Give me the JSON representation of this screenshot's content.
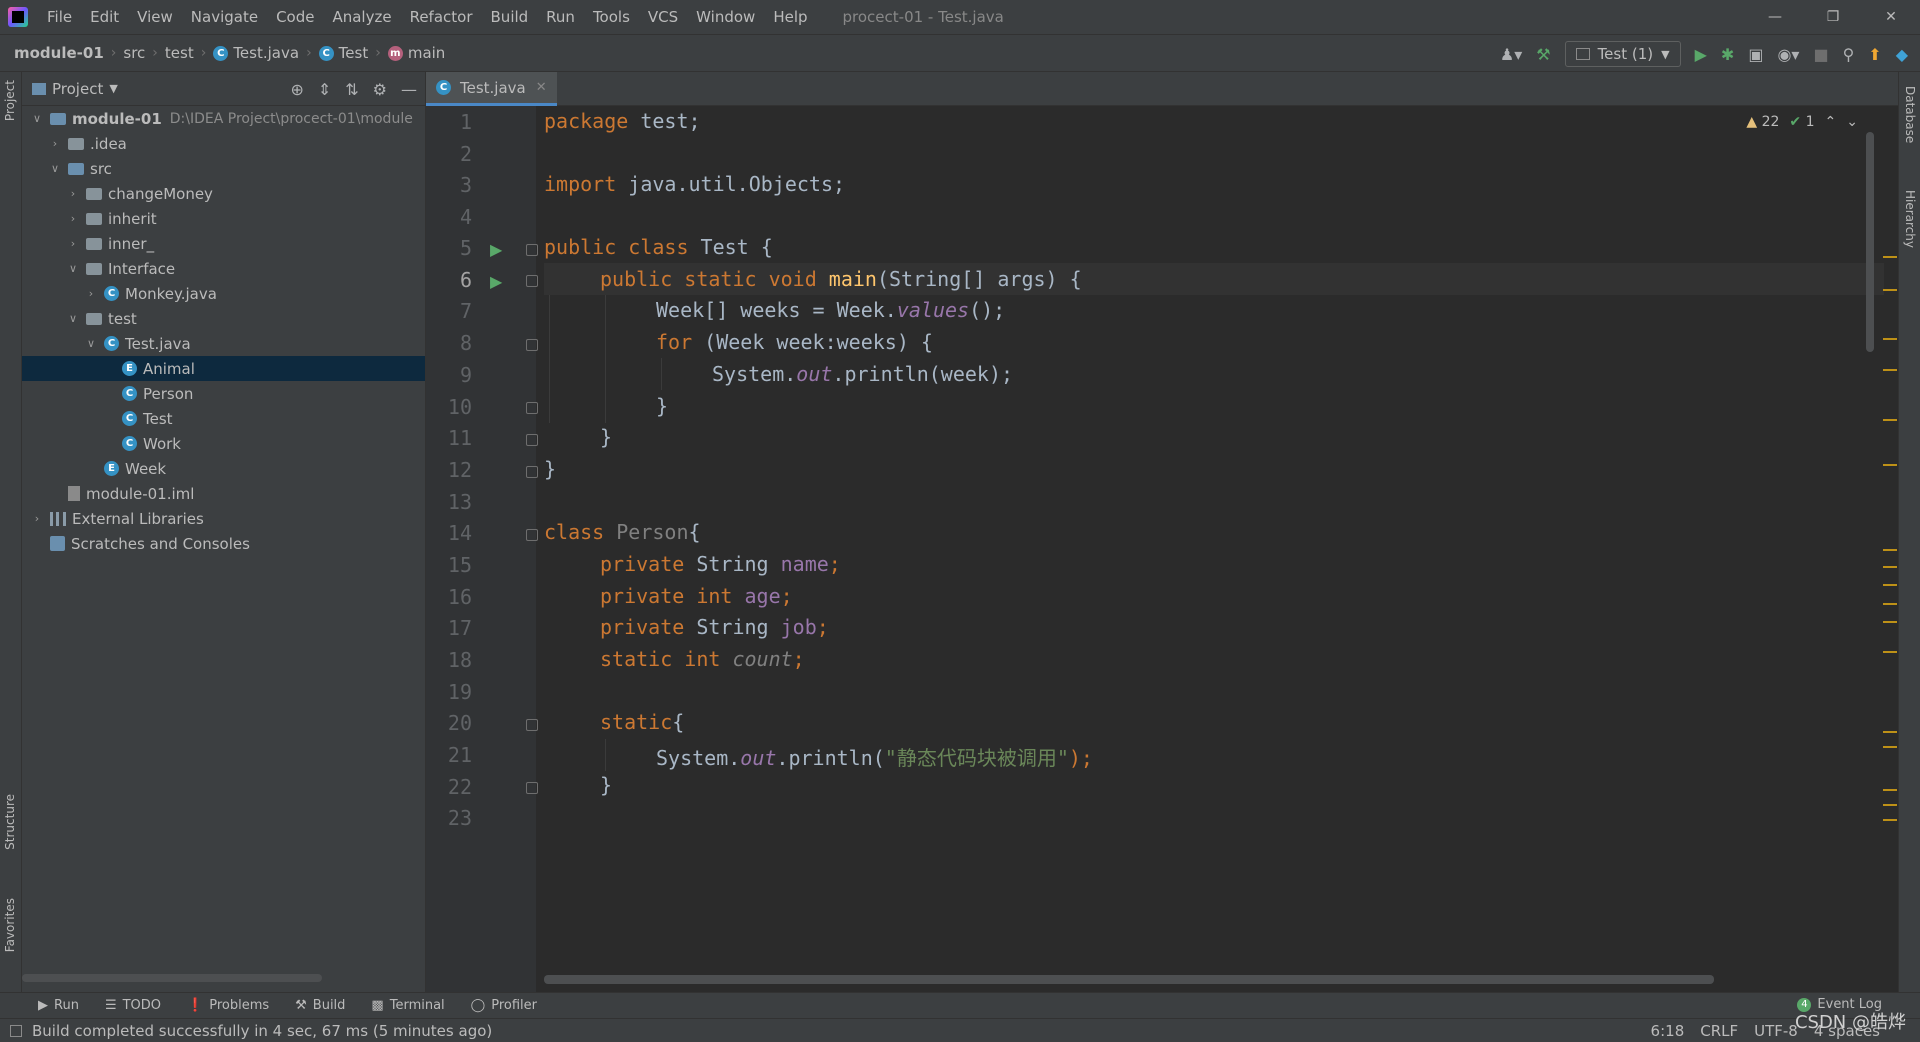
{
  "menubar": {
    "items": [
      "File",
      "Edit",
      "View",
      "Navigate",
      "Code",
      "Analyze",
      "Refactor",
      "Build",
      "Run",
      "Tools",
      "VCS",
      "Window",
      "Help"
    ],
    "window_title": "procect-01 - Test.java"
  },
  "breadcrumb": {
    "module": "module-01",
    "src": "src",
    "pkg": "test",
    "file": "Test.java",
    "cls": "Test",
    "method": "main"
  },
  "run_config": {
    "label": "Test (1)"
  },
  "project_panel": {
    "title": "Project",
    "tree": [
      {
        "label": "module-01",
        "hint": "D:\\IDEA Project\\procect-01\\module"
      },
      {
        "label": ".idea"
      },
      {
        "label": "src"
      },
      {
        "label": "changeMoney"
      },
      {
        "label": "inherit"
      },
      {
        "label": "inner_"
      },
      {
        "label": "Interface"
      },
      {
        "label": "Monkey.java"
      },
      {
        "label": "test"
      },
      {
        "label": "Test.java"
      },
      {
        "label": "Animal"
      },
      {
        "label": "Person"
      },
      {
        "label": "Test"
      },
      {
        "label": "Work"
      },
      {
        "label": "Week"
      },
      {
        "label": "module-01.iml"
      },
      {
        "label": "External Libraries"
      },
      {
        "label": "Scratches and Consoles"
      }
    ]
  },
  "editor": {
    "tab": "Test.java",
    "warnings": "22",
    "checks": "1",
    "line_numbers": [
      "1",
      "2",
      "3",
      "4",
      "5",
      "6",
      "7",
      "8",
      "9",
      "10",
      "11",
      "12",
      "13",
      "14",
      "15",
      "16",
      "17",
      "18",
      "19",
      "20",
      "21",
      "22",
      "23"
    ],
    "code": {
      "l1_kw": "package",
      "l1_rest": " test;",
      "l3_kw": "import",
      "l3_rest": " java.util.Objects;",
      "l5_kw": "public class",
      "l5_rest": " Test {",
      "l6_kw": "public static void",
      "l6_fn": "main",
      "l6_rest": "(String[] args) {",
      "l7_a": "Week[] weeks = Week.",
      "l7_b": "values",
      "l7_c": "();",
      "l8_kw": "for",
      "l8_rest": " (Week week:weeks) {",
      "l9_a": "System.",
      "l9_b": "out",
      "l9_c": ".println(week);",
      "l10": "}",
      "l11": "}",
      "l12": "}",
      "l14_kw": "class",
      "l14_cls": " Person",
      "l14_rest": "{",
      "l15_kw": "private",
      "l15_type": " String ",
      "l15_fld": "name",
      "l15_end": ";",
      "l16_kw": "private int",
      "l16_fld": " age",
      "l16_end": ";",
      "l17_kw": "private",
      "l17_type": " String ",
      "l17_fld": "job",
      "l17_end": ";",
      "l18_kw": "static int",
      "l18_fld": " count",
      "l18_end": ";",
      "l20_kw": "static",
      "l20_rest": "{",
      "l21_a": "System.",
      "l21_b": "out",
      "l21_c": ".println(",
      "l21_str": "\"静态代码块被调用\"",
      "l21_end": ");",
      "l22": "}"
    }
  },
  "tool_windows": {
    "run": "Run",
    "todo": "TODO",
    "problems": "Problems",
    "build": "Build",
    "terminal": "Terminal",
    "profiler": "Profiler",
    "event_log": "Event Log",
    "event_count": "4"
  },
  "side_tabs": {
    "project": "Project",
    "structure": "Structure",
    "favorites": "Favorites",
    "database": "Database",
    "hierarchy": "Hierarchy"
  },
  "status": {
    "message": "Build completed successfully in 4 sec, 67 ms (5 minutes ago)",
    "position": "6:18",
    "line_sep": "CRLF",
    "encoding": "UTF-8",
    "indent": "4 spaces"
  },
  "watermark": "CSDN @皓烨",
  "colors": {
    "keyword": "#cc7832",
    "function": "#ffc66d",
    "field": "#9876aa",
    "string": "#6a8759",
    "selection": "#0d293e"
  }
}
